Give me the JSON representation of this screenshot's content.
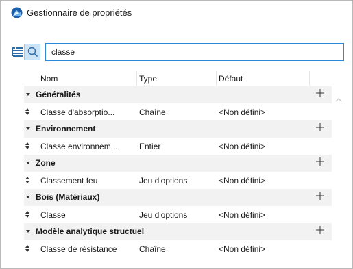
{
  "window": {
    "title": "Gestionnaire de propriétés"
  },
  "search": {
    "value": "classe"
  },
  "table": {
    "columns": [
      "Nom",
      "Type",
      "Défaut"
    ],
    "groups": [
      {
        "name": "Généralités",
        "items": [
          {
            "name": "Classe d'absorptio...",
            "type": "Chaîne",
            "default": "<Non défini>"
          }
        ]
      },
      {
        "name": "Environnement",
        "items": [
          {
            "name": "Classe environnem...",
            "type": "Entier",
            "default": "<Non défini>"
          }
        ]
      },
      {
        "name": "Zone",
        "items": [
          {
            "name": "Classement feu",
            "type": "Jeu d'options",
            "default": "<Non défini>"
          }
        ]
      },
      {
        "name": "Bois (Matériaux)",
        "items": [
          {
            "name": "Classe",
            "type": "Jeu d'options",
            "default": "<Non défini>"
          }
        ]
      },
      {
        "name": "Modèle analytique structuel",
        "items": [
          {
            "name": "Classe de résistance",
            "type": "Chaîne",
            "default": "<Non défini>"
          }
        ]
      }
    ]
  },
  "icons": {
    "app": "archicad-logo-icon",
    "tree": "tree-view-icon",
    "search": "search-icon",
    "caret": "caret-down-icon",
    "add": "plus-icon",
    "reorder": "up-down-arrows-icon",
    "scroll": "scroll-up-icon"
  },
  "colors": {
    "accent": "#2b8ad8",
    "search_button_bg": "#cce4f7",
    "group_row_bg": "#f2f2f2"
  }
}
